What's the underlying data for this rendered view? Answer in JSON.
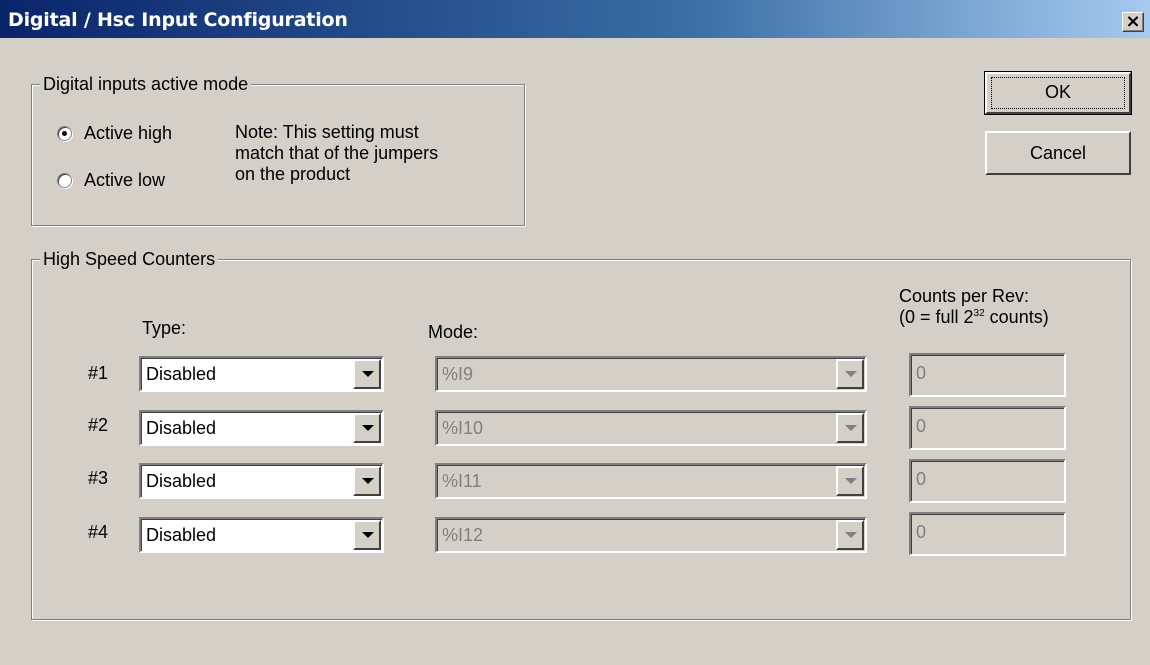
{
  "window": {
    "title": "Digital / Hsc Input Configuration",
    "close_label": "×"
  },
  "digital": {
    "legend": "Digital inputs active mode",
    "options": [
      {
        "label": "Active high",
        "checked": true
      },
      {
        "label": "Active low",
        "checked": false
      }
    ],
    "note": [
      "Note: This setting must",
      "match that of the jumpers",
      "on the product"
    ]
  },
  "buttons": {
    "ok": "OK",
    "cancel": "Cancel"
  },
  "hsc": {
    "legend": "High Speed Counters",
    "type_header": "Type:",
    "mode_header": "Mode:",
    "counts_header_1": "Counts per Rev:",
    "counts_header_2a": "(0 = full 2",
    "counts_header_sup": "32",
    "counts_header_2b": " counts)",
    "rows": [
      {
        "label": "#1",
        "type": "Disabled",
        "mode": "%I9",
        "counts": "0"
      },
      {
        "label": "#2",
        "type": "Disabled",
        "mode": "%I10",
        "counts": "0"
      },
      {
        "label": "#3",
        "type": "Disabled",
        "mode": "%I11",
        "counts": "0"
      },
      {
        "label": "#4",
        "type": "Disabled",
        "mode": "%I12",
        "counts": "0"
      }
    ]
  }
}
